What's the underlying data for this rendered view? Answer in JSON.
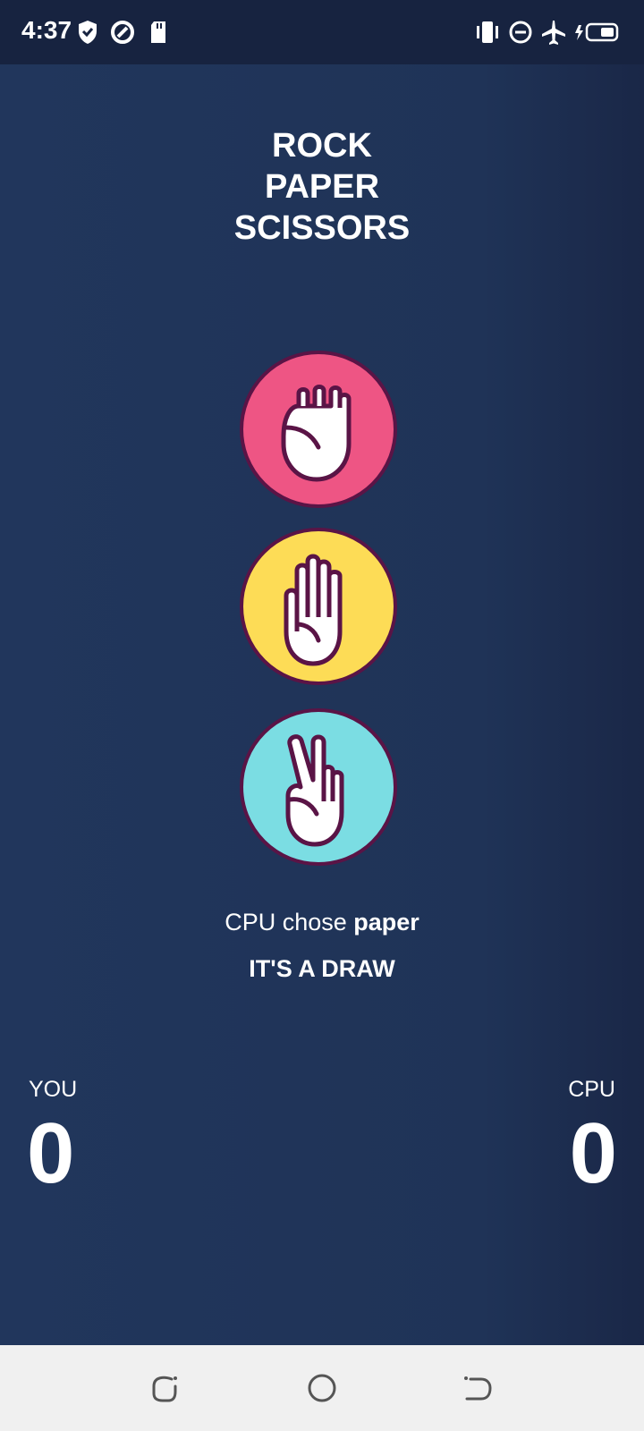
{
  "status_bar": {
    "time": "4:37",
    "left_icons": [
      "shield-check-icon",
      "data-saver-icon",
      "sd-card-icon"
    ],
    "right_icons": [
      "vibrate-icon",
      "do-not-disturb-icon",
      "airplane-mode-icon",
      "battery-charging-icon"
    ]
  },
  "game": {
    "title_lines": [
      "ROCK",
      "PAPER",
      "SCISSORS"
    ],
    "choices": [
      {
        "name": "rock",
        "icon": "fist-icon",
        "color": "#ee5584"
      },
      {
        "name": "paper",
        "icon": "open-hand-icon",
        "color": "#fddc56"
      },
      {
        "name": "scissors",
        "icon": "peace-hand-icon",
        "color": "#7bdde3"
      }
    ],
    "cpu_prefix": "CPU chose ",
    "cpu_choice": "paper",
    "outcome": "IT'S A DRAW"
  },
  "score": {
    "you_label": "YOU",
    "you_value": "0",
    "cpu_label": "CPU",
    "cpu_value": "0"
  },
  "nav": {
    "buttons": [
      "recents-icon",
      "home-icon",
      "back-icon"
    ]
  },
  "colors": {
    "background": "#1f3357",
    "status_bar": "#172340",
    "outline": "#5a1446"
  }
}
